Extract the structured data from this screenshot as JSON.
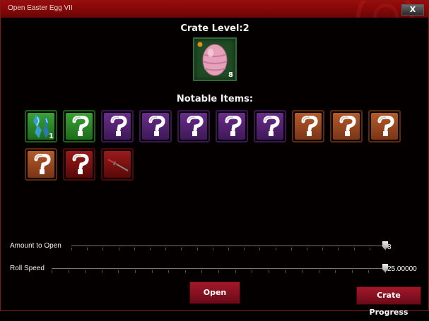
{
  "window": {
    "title": "Open Easter Egg VII",
    "close_label": "X"
  },
  "crate": {
    "level_text": "Crate Level:2",
    "count": "8",
    "icon": "easter-egg-icon"
  },
  "notable": {
    "heading": "Notable Items:",
    "items": [
      {
        "rarity": "green",
        "icon": "blue-crystal-icon",
        "badge": "1"
      },
      {
        "rarity": "green",
        "icon": "question-mark-icon",
        "badge": ""
      },
      {
        "rarity": "purple",
        "icon": "question-mark-icon",
        "badge": ""
      },
      {
        "rarity": "purple",
        "icon": "question-mark-icon",
        "badge": ""
      },
      {
        "rarity": "purple",
        "icon": "question-mark-icon",
        "badge": ""
      },
      {
        "rarity": "purple",
        "icon": "question-mark-icon",
        "badge": ""
      },
      {
        "rarity": "purple",
        "icon": "question-mark-icon",
        "badge": ""
      },
      {
        "rarity": "orange",
        "icon": "question-mark-icon",
        "badge": ""
      },
      {
        "rarity": "orange",
        "icon": "question-mark-icon",
        "badge": ""
      },
      {
        "rarity": "orange",
        "icon": "question-mark-icon",
        "badge": ""
      },
      {
        "rarity": "orange",
        "icon": "question-mark-icon",
        "badge": ""
      },
      {
        "rarity": "red",
        "icon": "question-mark-icon",
        "badge": ""
      },
      {
        "rarity": "red",
        "icon": "sword-icon",
        "badge": ""
      }
    ]
  },
  "sliders": {
    "amount": {
      "label": "Amount to Open",
      "value": "8",
      "level": 1.0
    },
    "speed": {
      "label": "Roll Speed",
      "value": "25.00000",
      "level": 1.0
    }
  },
  "buttons": {
    "open": "Open",
    "progress": "Crate Progress"
  },
  "colors": {
    "accent": "#9e0a0a",
    "background": "#050000"
  }
}
